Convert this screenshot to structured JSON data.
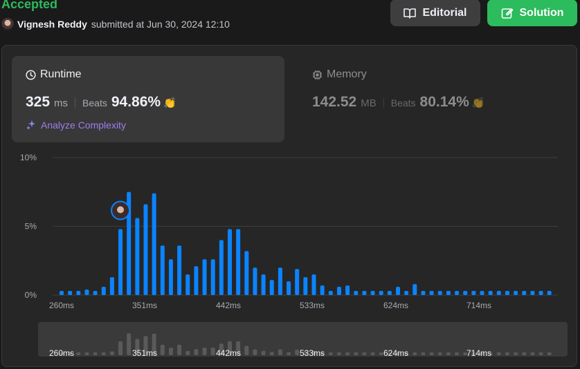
{
  "header": {
    "status": "Accepted",
    "user_name": "Vignesh Reddy",
    "submitted_text": "submitted at Jun 30, 2024 12:10",
    "editorial_label": "Editorial",
    "solution_label": "Solution"
  },
  "runtime": {
    "title": "Runtime",
    "value": "325",
    "unit": "ms",
    "beats_label": "Beats",
    "beats_value": "94.86%",
    "analyze_label": "Analyze Complexity"
  },
  "memory": {
    "title": "Memory",
    "value": "142.52",
    "unit": "MB",
    "beats_label": "Beats",
    "beats_value": "80.14%"
  },
  "colors": {
    "accent_green": "#2cbb5d",
    "bar_blue": "#0a84ff",
    "analyze_purple": "#9c7ff0"
  },
  "chart_data": {
    "type": "bar",
    "y_tick_labels": [
      "10%",
      "5%",
      "0%"
    ],
    "ylim": [
      0,
      10
    ],
    "x_tick_labels": [
      "260ms",
      "351ms",
      "442ms",
      "533ms",
      "624ms",
      "714ms"
    ],
    "values": [
      0.3,
      0.3,
      0.3,
      0.4,
      0.3,
      0.6,
      1.3,
      4.8,
      7.5,
      5.6,
      6.6,
      7.4,
      3.6,
      2.6,
      3.6,
      1.5,
      2.1,
      2.6,
      2.6,
      4.0,
      4.8,
      4.8,
      3.2,
      2.0,
      1.5,
      1.1,
      2.0,
      1.0,
      1.9,
      1.3,
      1.5,
      0.7,
      0.3,
      0.6,
      0.7,
      0.3,
      0.3,
      0.3,
      0.3,
      0.3,
      0.6,
      0.3,
      0.8,
      0.3,
      0.3,
      0.3,
      0.3,
      0.3,
      0.3,
      0.3,
      0.3,
      0.3,
      0.3,
      0.3,
      0.3,
      0.3,
      0.3,
      0.3,
      0.3
    ],
    "highlight_index": 7,
    "grid": true
  }
}
